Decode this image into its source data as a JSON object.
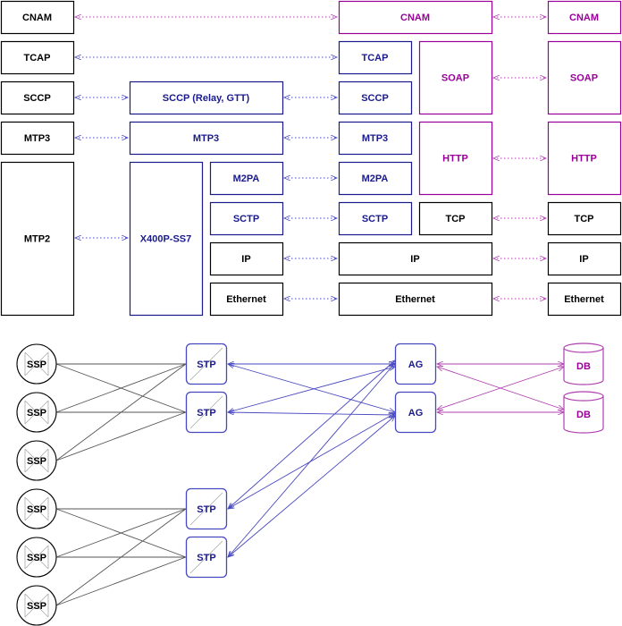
{
  "colors": {
    "black": "#000000",
    "blue": "#1a1a8c",
    "purple": "#990099",
    "link_blue": "#4848c0",
    "link_purple": "#b040b0",
    "diag": "#aaaaaa"
  },
  "stack": {
    "ssp": [
      "CNAM",
      "TCAP",
      "SCCP",
      "MTP3",
      "MTP2"
    ],
    "stp": [
      "SCCP (Relay, GTT)",
      "MTP3",
      "X400P-SS7",
      "M2PA",
      "SCTP",
      "IP",
      "Ethernet"
    ],
    "ag_ss7": [
      "TCAP",
      "SCCP",
      "MTP3",
      "M2PA",
      "SCTP"
    ],
    "ag_app": [
      "CNAM",
      "SOAP",
      "HTTP",
      "TCP"
    ],
    "ag_net": [
      "IP",
      "Ethernet"
    ],
    "db": [
      "CNAM",
      "SOAP",
      "HTTP",
      "TCP",
      "IP",
      "Ethernet"
    ]
  },
  "network": {
    "ssp_label": "SSP",
    "stp_label": "STP",
    "ag_label": "AG",
    "db_label": "DB"
  }
}
